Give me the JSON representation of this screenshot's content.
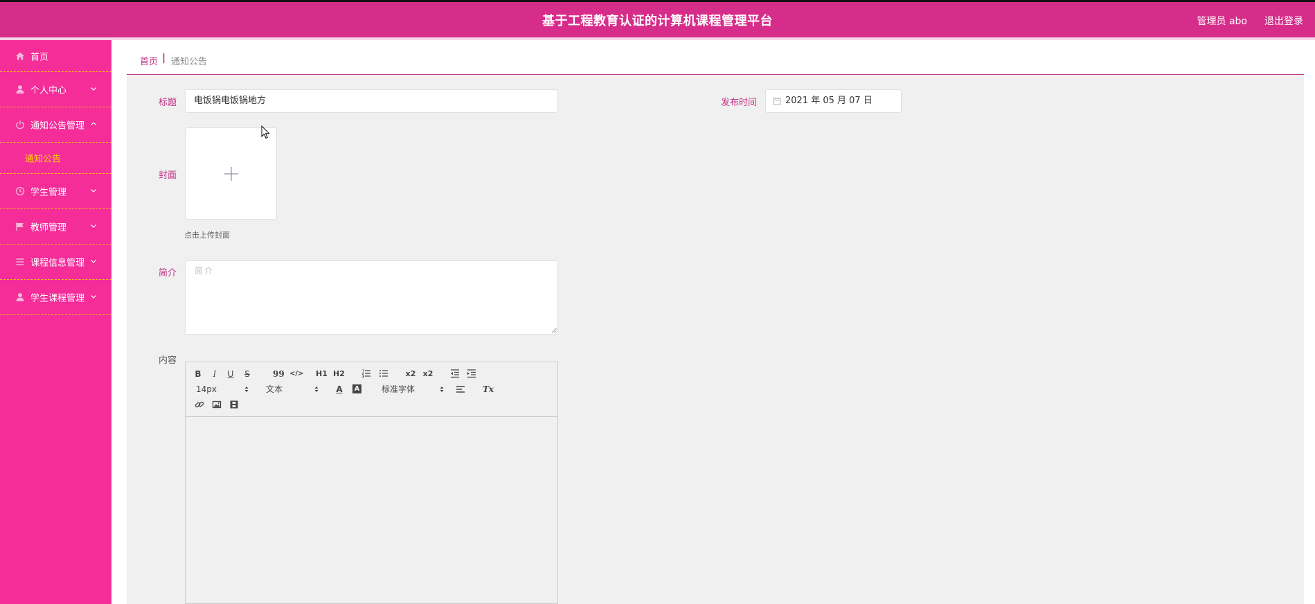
{
  "header": {
    "title": "基于工程教育认证的计算机课程管理平台",
    "user_text": "管理员 abo",
    "logout_label": "退出登录"
  },
  "sidebar": {
    "items": [
      {
        "label": "首页",
        "icon": "home-icon",
        "has_chevron": false
      },
      {
        "label": "个人中心",
        "icon": "user-icon",
        "chevron": "down"
      },
      {
        "label": "通知公告管理",
        "icon": "power-icon",
        "chevron": "up"
      },
      {
        "label": "学生管理",
        "icon": "clock-icon",
        "chevron": "down"
      },
      {
        "label": "教师管理",
        "icon": "flag-icon",
        "chevron": "down"
      },
      {
        "label": "课程信息管理",
        "icon": "list-icon",
        "chevron": "down"
      },
      {
        "label": "学生课程管理",
        "icon": "user-icon",
        "chevron": "down"
      }
    ],
    "sub_items": [
      {
        "label": "通知公告",
        "parent": "通知公告管理",
        "active": true
      }
    ]
  },
  "breadcrumb": {
    "home": "首页",
    "separator": "|",
    "current": "通知公告"
  },
  "form": {
    "title_label": "标题",
    "title_value": "电饭锅电饭锅地方",
    "date_label": "发布时间",
    "date_value": "2021 年 05 月 07 日",
    "cover_label": "封面",
    "cover_tip": "点击上传封面",
    "intro_label": "简介",
    "intro_placeholder": "简介",
    "content_label": "内容"
  },
  "editor": {
    "font_size": "14px",
    "block_type": "文本",
    "font_family": "标准字体",
    "buttons": [
      "bold",
      "italic",
      "underline",
      "strike",
      "blockquote",
      "code-block",
      "header-1",
      "header-2",
      "ordered-list",
      "bullet-list",
      "subscript",
      "superscript",
      "outdent",
      "indent",
      "font-color",
      "background-color",
      "align",
      "clean",
      "link",
      "image",
      "video"
    ],
    "bold_glyph": "B",
    "italic_glyph": "I",
    "underline_glyph": "U",
    "strike_glyph": "S",
    "quote_glyph": "99",
    "code_glyph": "</>",
    "h1_glyph": "H1",
    "h2_glyph": "H2",
    "sub_glyph": "x2",
    "sup_glyph": "x2",
    "color_glyph": "A",
    "bg_glyph": "A",
    "clean_glyph": "Tx"
  },
  "colors": {
    "header_bg": "#d72d8a",
    "sidebar_bg": "#f42d99",
    "active_sub": "#ffd400",
    "accent": "#c12d84",
    "divider": "#ffc107"
  }
}
